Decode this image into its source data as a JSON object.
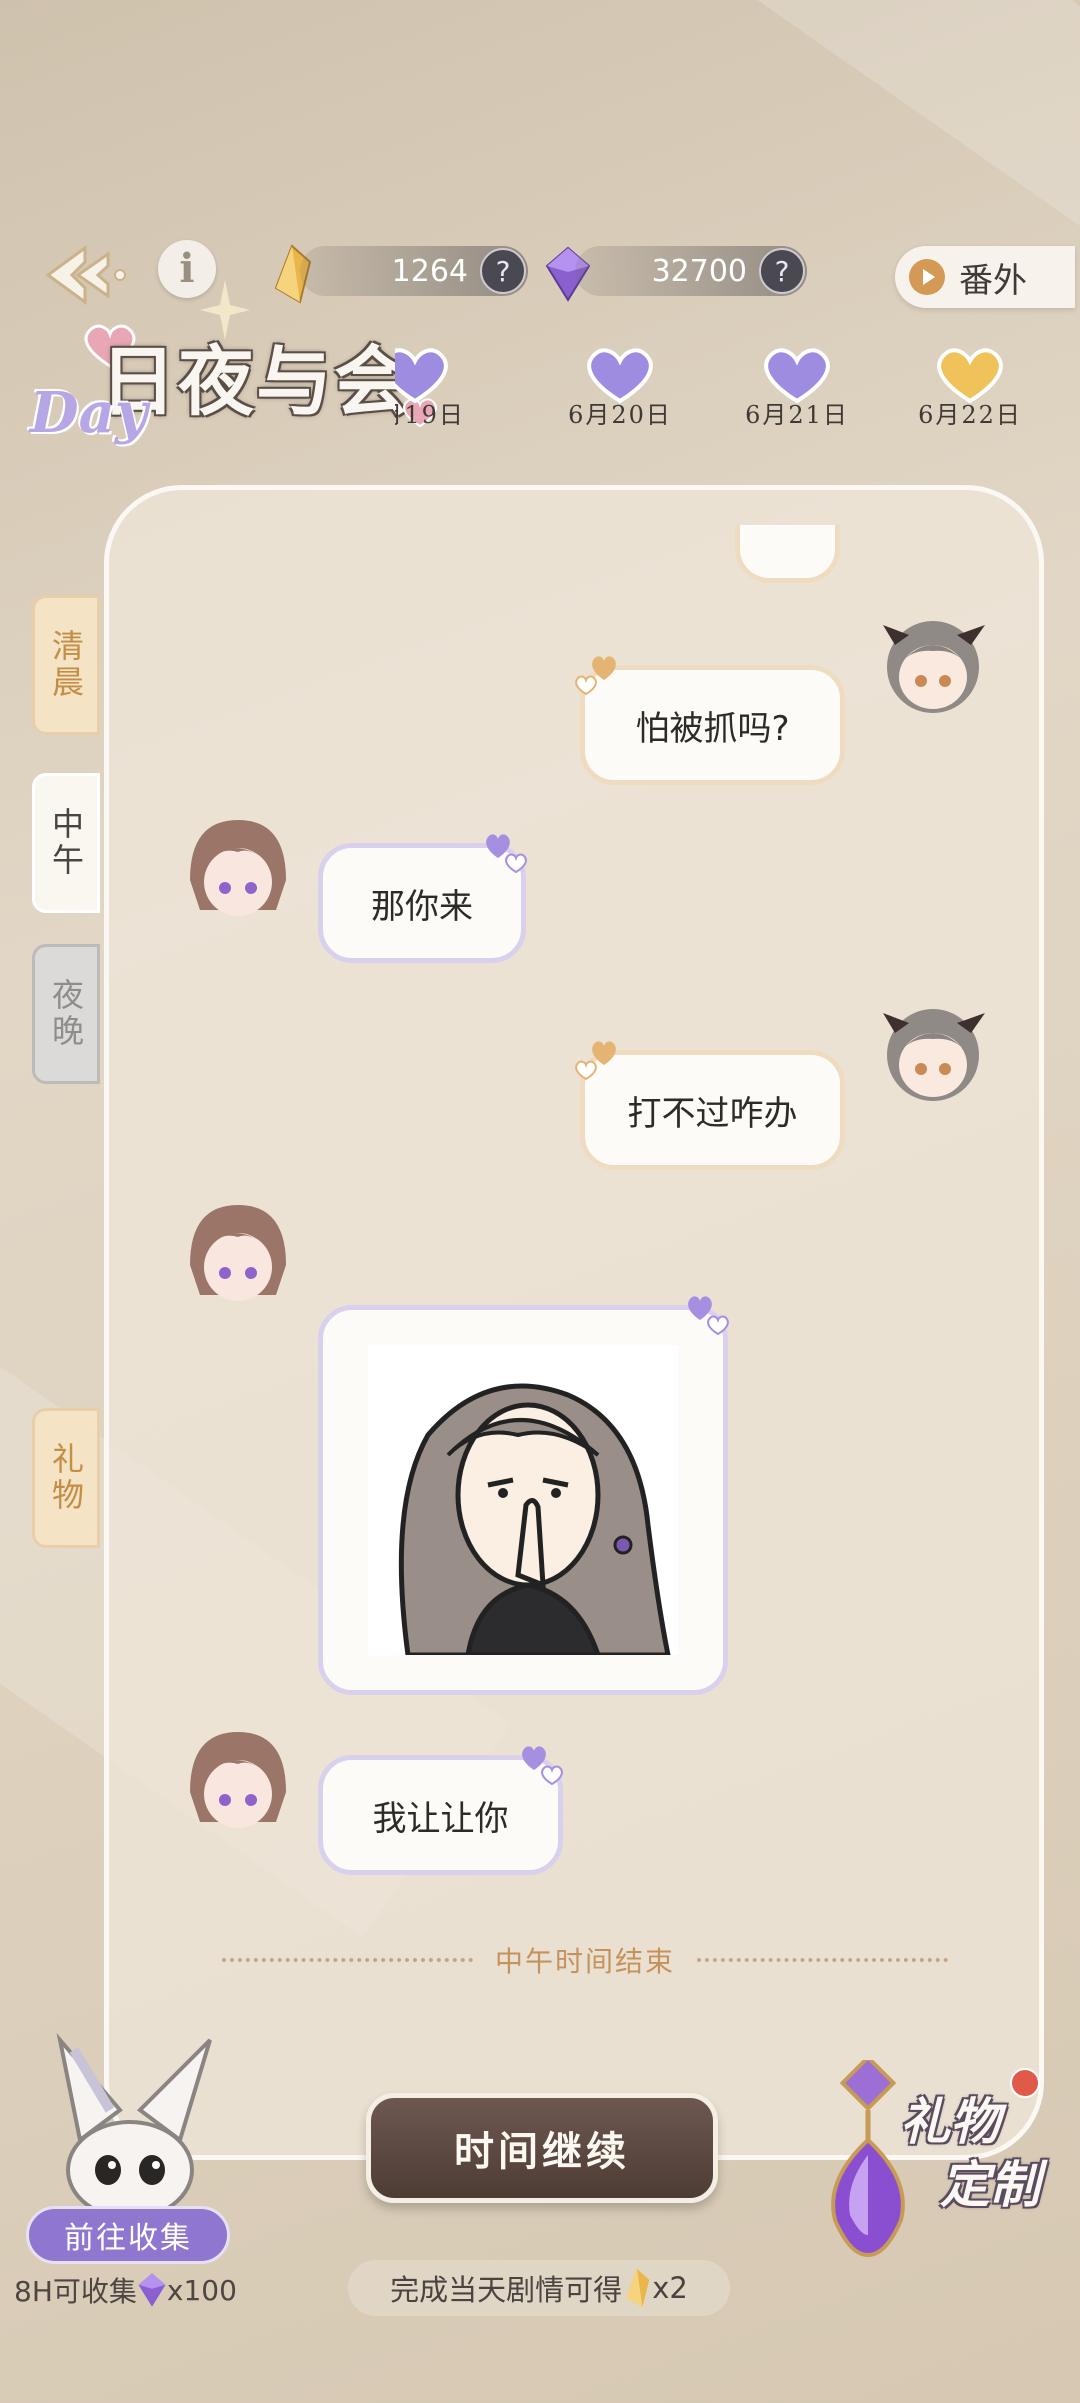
{
  "header": {
    "currency1_value": "1264",
    "currency2_value": "32700",
    "help_glyph": "?",
    "info_glyph": "i",
    "extra_label": "番外"
  },
  "title": {
    "main": "日夜与会",
    "day": "Day"
  },
  "dates": [
    {
      "label": "6月19日",
      "color": "#9d8ce0"
    },
    {
      "label": "6月20日",
      "color": "#9d8ce0"
    },
    {
      "label": "6月21日",
      "color": "#9d8ce0"
    },
    {
      "label": "6月22日",
      "color": "#f0c35a"
    }
  ],
  "tabs": {
    "morning": "清晨",
    "noon": "中午",
    "night": "夜晚",
    "gift": "礼物"
  },
  "chat": {
    "msg1": "怕被抓吗?",
    "msg2": "那你来",
    "msg3": "打不过咋办",
    "msg5": "我让让你",
    "divider": "中午时间结束"
  },
  "bottom": {
    "continue_label": "时间继续",
    "collect_label": "前往收集",
    "collect_note_prefix": "8H可收集",
    "collect_note_suffix": "x100",
    "reward_prefix": "完成当天剧情可得",
    "reward_suffix": "x2",
    "gift_custom_line1": "礼物",
    "gift_custom_line2": "定制"
  },
  "colors": {
    "accent_purple": "#9d8ce0",
    "accent_gold": "#f0c35a",
    "button_brown": "#5c4840"
  },
  "icons": {
    "back": "back-arrow-icon",
    "info": "info-icon",
    "gold_crystal": "gold-crystal-icon",
    "purple_gem": "purple-gem-icon",
    "play": "play-icon",
    "heart": "heart-icon",
    "rabbit": "rabbit-mascot-icon",
    "earring": "earring-gem-icon"
  }
}
